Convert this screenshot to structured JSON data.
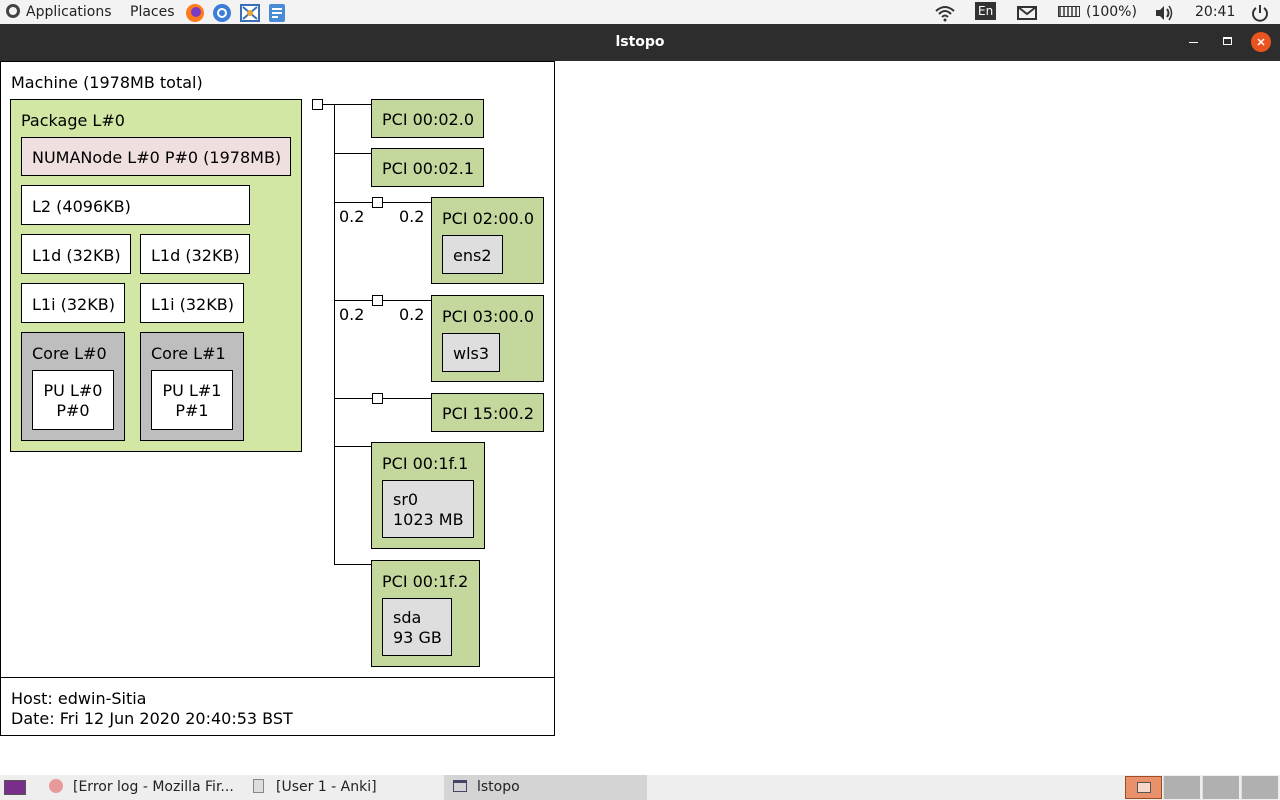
{
  "top_panel": {
    "applications_label": "Applications",
    "places_label": "Places",
    "keyboard_label": "En",
    "battery_label": "(100%)",
    "clock": "20:41"
  },
  "window": {
    "title": "lstopo"
  },
  "topology": {
    "machine": "Machine (1978MB total)",
    "package": "Package L#0",
    "numa": "NUMANode L#0 P#0 (1978MB)",
    "l2": "L2 (4096KB)",
    "l1d_0": "L1d (32KB)",
    "l1d_1": "L1d (32KB)",
    "l1i_0": "L1i (32KB)",
    "l1i_1": "L1i (32KB)",
    "core_0": "Core L#0",
    "core_1": "Core L#1",
    "pu_0": "PU L#0\nP#0",
    "pu_1": "PU L#1\nP#1",
    "pci": [
      {
        "label": "PCI 00:02.0"
      },
      {
        "label": "PCI 00:02.1"
      },
      {
        "label": "PCI 02:00.0",
        "device": "ens2",
        "speed_left": "0.2",
        "speed_right": "0.2"
      },
      {
        "label": "PCI 03:00.0",
        "device": "wls3",
        "speed_left": "0.2",
        "speed_right": "0.2"
      },
      {
        "label": "PCI 15:00.2"
      },
      {
        "label": "PCI 00:1f.1",
        "device": "sr0\n1023 MB"
      },
      {
        "label": "PCI 00:1f.2",
        "device": "sda\n93 GB"
      }
    ],
    "host": "Host: edwin-Sitia",
    "date": "Date: Fri 12 Jun 2020 20:40:53 BST"
  },
  "taskbar": {
    "items": [
      {
        "label": "[Error log - Mozilla Fir..."
      },
      {
        "label": "[User 1 - Anki]"
      },
      {
        "label": "lstopo"
      }
    ]
  },
  "colors": {
    "package": "#d2e7a4",
    "numa": "#efdfde",
    "core": "#bebebe",
    "pci": "#c4d79c",
    "os_device": "#dedede",
    "close_button": "#e95420"
  }
}
